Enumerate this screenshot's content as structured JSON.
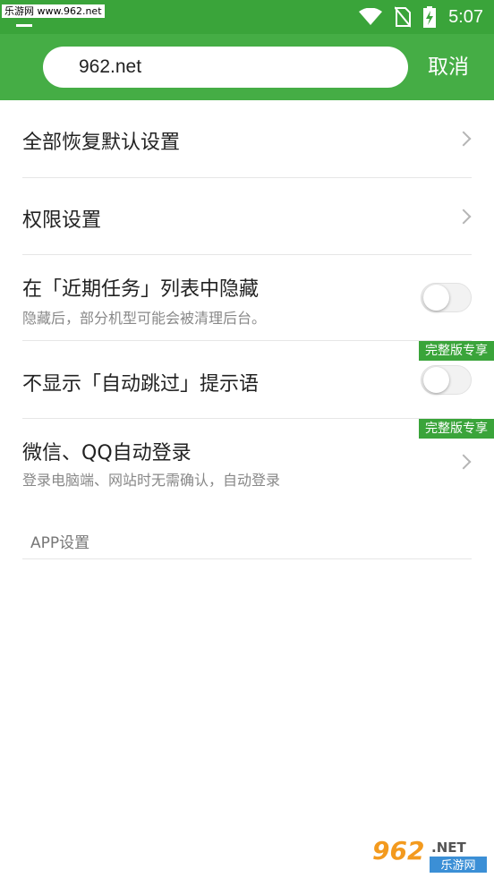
{
  "status_bar": {
    "watermark": "乐游网 www.962.net",
    "time": "5:07",
    "icons": [
      "wifi-icon",
      "no-sim-icon",
      "battery-charging-icon"
    ]
  },
  "topbar": {
    "search_value": "962.net",
    "cancel_label": "取消"
  },
  "settings": {
    "items": [
      {
        "title": "全部恢复默认设置",
        "type": "link"
      },
      {
        "title": "权限设置",
        "type": "link"
      },
      {
        "title": "在「近期任务」列表中隐藏",
        "subtitle": "隐藏后，部分机型可能会被清理后台。",
        "type": "toggle",
        "on": false
      },
      {
        "title": "不显示「自动跳过」提示语",
        "badge": "完整版专享",
        "type": "toggle",
        "on": false
      },
      {
        "title": "微信、QQ自动登录",
        "subtitle": "登录电脑端、网站时无需确认，自动登录",
        "badge": "完整版专享",
        "type": "link"
      }
    ]
  },
  "section_header": "APP设置",
  "logo": {
    "brand": "962.NET",
    "subtitle": "乐游网"
  },
  "colors": {
    "status_green": "#3aa43a",
    "toolbar_green": "#45ad45",
    "logo_orange": "#f39a1e"
  }
}
